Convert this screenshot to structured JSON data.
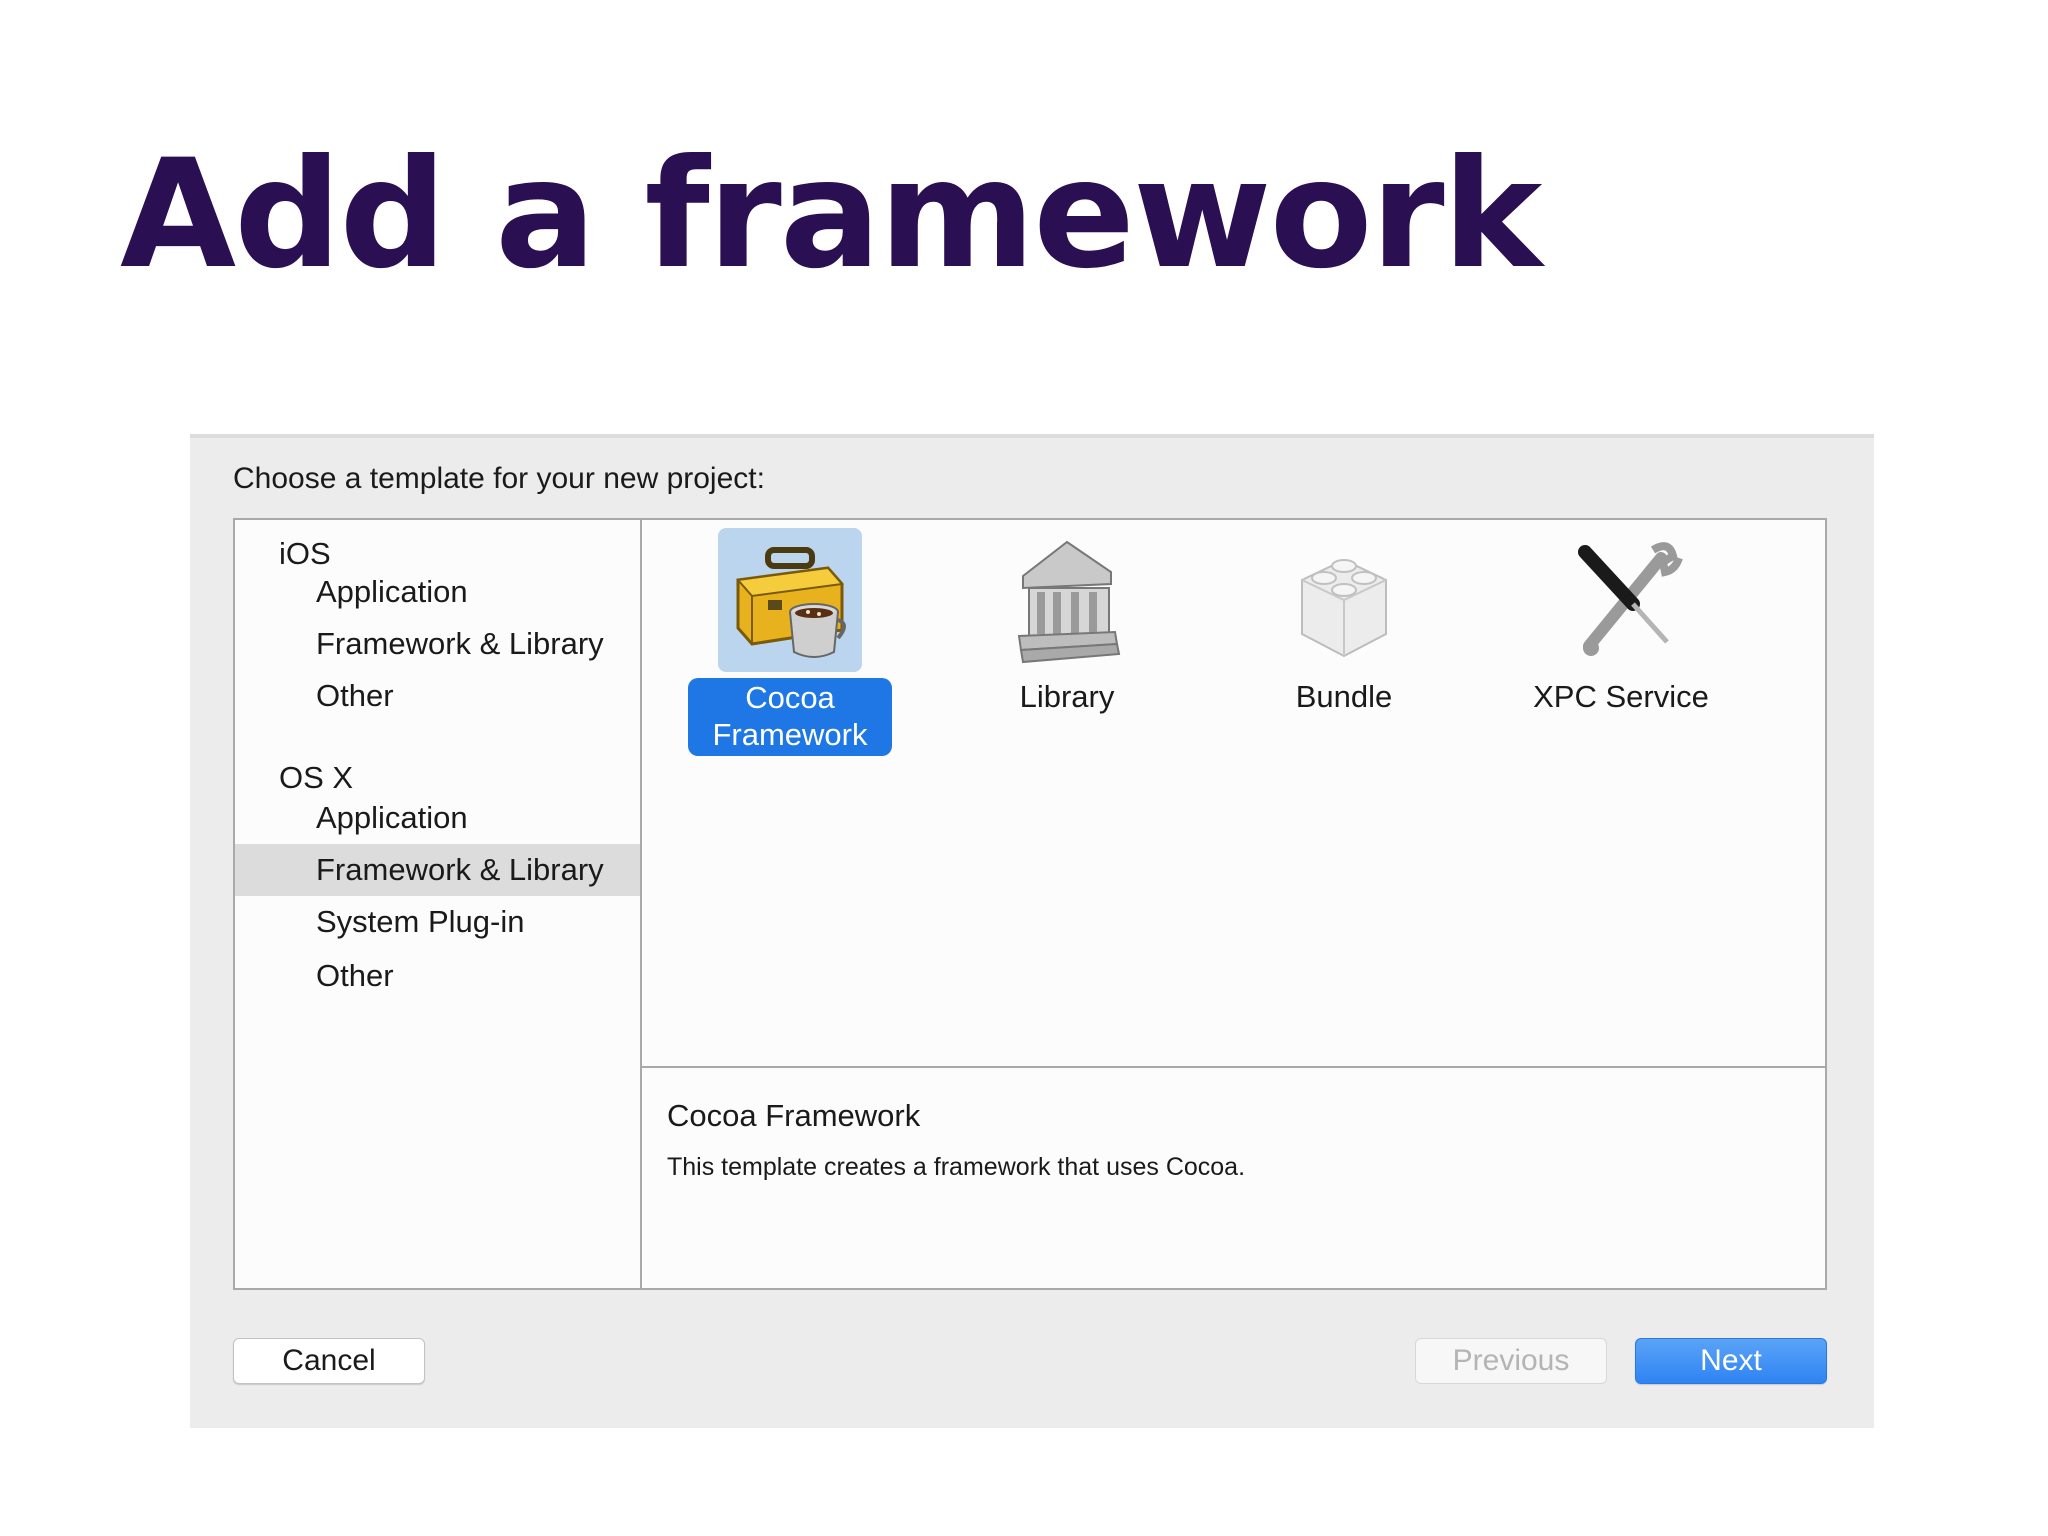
{
  "slide": {
    "title": "Add a framework"
  },
  "dialog": {
    "prompt": "Choose a template for your new project:",
    "sidebar": {
      "groups": [
        {
          "header": "iOS",
          "items": [
            "Application",
            "Framework & Library",
            "Other"
          ]
        },
        {
          "header": "OS X",
          "items": [
            "Application",
            "Framework & Library",
            "System Plug-in",
            "Other"
          ]
        }
      ],
      "selected": "OS X / Framework & Library"
    },
    "templates": [
      {
        "label_line1": "Cocoa",
        "label_line2": "Framework",
        "icon": "toolbox-coffee-icon",
        "selected": true
      },
      {
        "label": "Library",
        "icon": "library-building-icon",
        "selected": false
      },
      {
        "label": "Bundle",
        "icon": "lego-brick-icon",
        "selected": false
      },
      {
        "label": "XPC Service",
        "icon": "screwdriver-wrench-icon",
        "selected": false
      }
    ],
    "description": {
      "title": "Cocoa Framework",
      "text": "This template creates a framework that uses Cocoa."
    },
    "buttons": {
      "cancel": "Cancel",
      "previous": "Previous",
      "next": "Next"
    }
  },
  "colors": {
    "title": "#2a0f52",
    "selection_blue": "#1f77e5",
    "selection_tint": "#bcd5ef",
    "sidebar_selected": "#dcdcdc"
  }
}
